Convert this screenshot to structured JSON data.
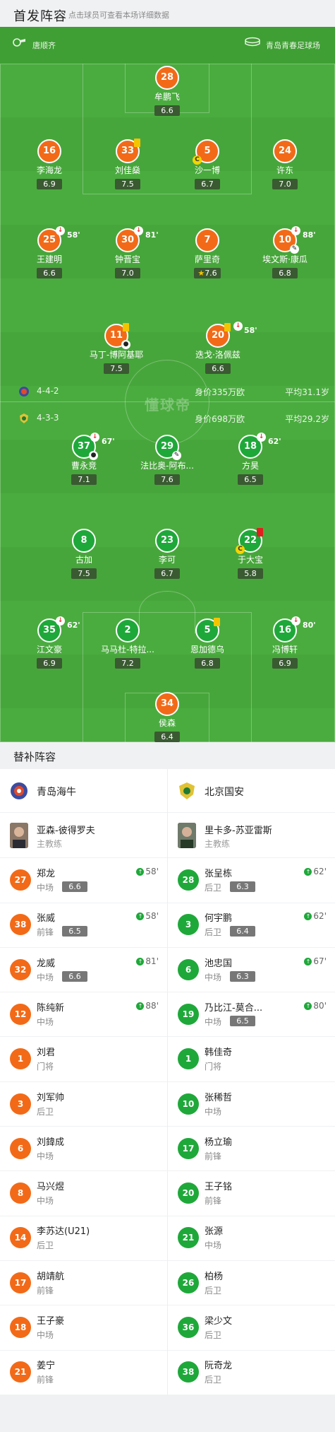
{
  "header": {
    "title": "首发阵容",
    "subtitle": "点击球员可查看本场详细数据"
  },
  "pitch": {
    "referee": "唐顺齐",
    "stadium": "青岛青春足球场",
    "watermark": "懂球帝"
  },
  "home_team": {
    "formation": "4-4-2",
    "value": "身价335万欧",
    "avg_age": "平均31.1岁",
    "color": "#f26a18",
    "players": [
      {
        "num": "28",
        "name": "牟鹏飞",
        "rating": "6.6"
      },
      {
        "num": "16",
        "name": "李海龙",
        "rating": "6.9"
      },
      {
        "num": "33",
        "name": "刘佳燊",
        "rating": "7.5"
      },
      {
        "num": "5",
        "name": "沙一博",
        "rating": "6.7"
      },
      {
        "num": "24",
        "name": "许东",
        "rating": "7.0"
      },
      {
        "num": "25",
        "name": "王建明",
        "rating": "6.6",
        "sub_min": "58'"
      },
      {
        "num": "30",
        "name": "钟晋宝",
        "rating": "7.0",
        "sub_min": "81'"
      },
      {
        "num": "7",
        "name": "萨里奇",
        "rating": "7.6"
      },
      {
        "num": "10",
        "name": "埃文斯·康瓜",
        "rating": "6.8",
        "sub_min": "88'"
      },
      {
        "num": "11",
        "name": "马丁-博阿基耶",
        "rating": "7.5"
      },
      {
        "num": "20",
        "name": "迭戈·洛佩兹",
        "rating": "6.6",
        "sub_min": "58'"
      }
    ]
  },
  "away_team": {
    "formation": "4-3-3",
    "value": "身价698万欧",
    "avg_age": "平均29.2岁",
    "color": "#1fa83a",
    "players": [
      {
        "num": "37",
        "name": "曹永竞",
        "rating": "7.1",
        "sub_min": "67'"
      },
      {
        "num": "29",
        "name": "法比奥-阿布...",
        "rating": "7.6"
      },
      {
        "num": "18",
        "name": "方昊",
        "rating": "6.5",
        "sub_min": "62'"
      },
      {
        "num": "8",
        "name": "古加",
        "rating": "7.5"
      },
      {
        "num": "23",
        "name": "李可",
        "rating": "6.7"
      },
      {
        "num": "22",
        "name": "于大宝",
        "rating": "5.8"
      },
      {
        "num": "35",
        "name": "江文豪",
        "rating": "6.9",
        "sub_min": "62'"
      },
      {
        "num": "2",
        "name": "马马杜-特拉...",
        "rating": "7.2"
      },
      {
        "num": "5",
        "name": "恩加德乌",
        "rating": "6.8"
      },
      {
        "num": "16",
        "name": "冯博轩",
        "rating": "6.9",
        "sub_min": "80'"
      },
      {
        "num": "34",
        "name": "侯森",
        "rating": "6.4"
      }
    ]
  },
  "subs_section": {
    "title": "替补阵容"
  },
  "subs_home": {
    "team_name": "青岛海牛",
    "coach_name": "亚森-彼得罗夫",
    "coach_role": "主教练",
    "players": [
      {
        "num": "27",
        "name": "郑龙",
        "pos": "中场",
        "rating": "6.6",
        "min": "58'"
      },
      {
        "num": "38",
        "name": "张威",
        "pos": "前锋",
        "rating": "6.5",
        "min": "58'"
      },
      {
        "num": "32",
        "name": "龙威",
        "pos": "中场",
        "rating": "6.6",
        "min": "81'"
      },
      {
        "num": "12",
        "name": "陈纯新",
        "pos": "中场",
        "rating": "",
        "min": "88'"
      },
      {
        "num": "1",
        "name": "刘君",
        "pos": "门将",
        "rating": "",
        "min": ""
      },
      {
        "num": "3",
        "name": "刘军帅",
        "pos": "后卫",
        "rating": "",
        "min": ""
      },
      {
        "num": "6",
        "name": "刘鍏成",
        "pos": "中场",
        "rating": "",
        "min": ""
      },
      {
        "num": "8",
        "name": "马兴煜",
        "pos": "中场",
        "rating": "",
        "min": ""
      },
      {
        "num": "14",
        "name": "李苏达(U21)",
        "pos": "后卫",
        "rating": "",
        "min": ""
      },
      {
        "num": "17",
        "name": "胡靖航",
        "pos": "前锋",
        "rating": "",
        "min": ""
      },
      {
        "num": "18",
        "name": "王子豪",
        "pos": "中场",
        "rating": "",
        "min": ""
      },
      {
        "num": "21",
        "name": "姜宁",
        "pos": "前锋",
        "rating": "",
        "min": ""
      }
    ]
  },
  "subs_away": {
    "team_name": "北京国安",
    "coach_name": "里卡多-苏亚雷斯",
    "coach_role": "主教练",
    "players": [
      {
        "num": "28",
        "name": "张呈栋",
        "pos": "后卫",
        "rating": "6.3",
        "min": "62'"
      },
      {
        "num": "3",
        "name": "何宇鹏",
        "pos": "后卫",
        "rating": "6.4",
        "min": "62'"
      },
      {
        "num": "6",
        "name": "池忠国",
        "pos": "中场",
        "rating": "6.3",
        "min": "67'"
      },
      {
        "num": "19",
        "name": "乃比江-莫合...",
        "pos": "中场",
        "rating": "6.5",
        "min": "80'"
      },
      {
        "num": "1",
        "name": "韩佳奇",
        "pos": "门将",
        "rating": "",
        "min": ""
      },
      {
        "num": "10",
        "name": "张稀哲",
        "pos": "中场",
        "rating": "",
        "min": ""
      },
      {
        "num": "17",
        "name": "杨立瑜",
        "pos": "前锋",
        "rating": "",
        "min": ""
      },
      {
        "num": "20",
        "name": "王子铭",
        "pos": "前锋",
        "rating": "",
        "min": ""
      },
      {
        "num": "21",
        "name": "张源",
        "pos": "中场",
        "rating": "",
        "min": ""
      },
      {
        "num": "26",
        "name": "柏杨",
        "pos": "后卫",
        "rating": "",
        "min": ""
      },
      {
        "num": "36",
        "name": "梁少文",
        "pos": "后卫",
        "rating": "",
        "min": ""
      },
      {
        "num": "38",
        "name": "阮奇龙",
        "pos": "后卫",
        "rating": "",
        "min": ""
      }
    ]
  }
}
